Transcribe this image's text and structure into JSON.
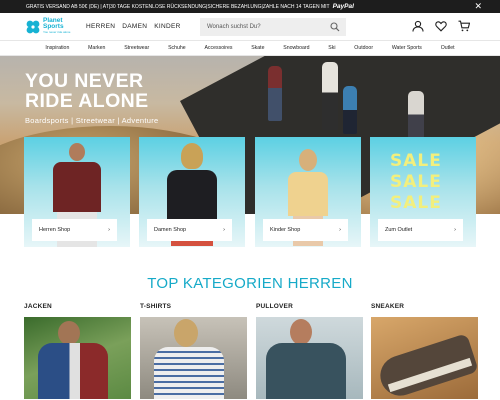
{
  "topbar": {
    "promo": "GRATIS VERSAND AB 50€ (DE) | AT|30 TAGE KOSTENLOSE RÜCKSENDUNG|SICHERE BEZAHLUNG|ZAHLE NACH 14 TAGEN MIT",
    "paypal": "PayPal",
    "close": "✕"
  },
  "header": {
    "logo_line1": "Planet",
    "logo_line2": "Sports",
    "logo_tagline": "You never ride alone",
    "gender_nav": [
      "HERREN",
      "DAMEN",
      "KINDER"
    ],
    "search_placeholder": "Wonach suchst Du?",
    "icons": [
      "account-icon",
      "wishlist-heart-icon",
      "cart-icon"
    ]
  },
  "categories": [
    "Inspiration",
    "Marken",
    "Streetwear",
    "Schuhe",
    "Accessoires",
    "Skate",
    "Snowboard",
    "Ski",
    "Outdoor",
    "Water Sports",
    "Outlet"
  ],
  "hero": {
    "headline_line1": "YOU NEVER",
    "headline_line2": "RIDE ALONE",
    "tags": "Boardsports  |  Streetwear  |  Adventure"
  },
  "cards": [
    {
      "label": "Herren Shop",
      "arrow": "›"
    },
    {
      "label": "Damen Shop",
      "arrow": "›"
    },
    {
      "label": "Kinder Shop",
      "arrow": "›"
    },
    {
      "label": "Zum Outlet",
      "arrow": "›"
    }
  ],
  "sale_text": [
    "SALE",
    "SALE",
    "SALE"
  ],
  "top_categories": {
    "title": "TOP KATEGORIEN HERREN",
    "items": [
      "JACKEN",
      "T-SHIRTS",
      "PULLOVER",
      "SNEAKER"
    ]
  },
  "colors": {
    "brand": "#16b2d3",
    "topbar_bg": "#1d1d1d",
    "card_gradient_top": "#5cd0e3",
    "sale_text": "#f2ef7d"
  }
}
